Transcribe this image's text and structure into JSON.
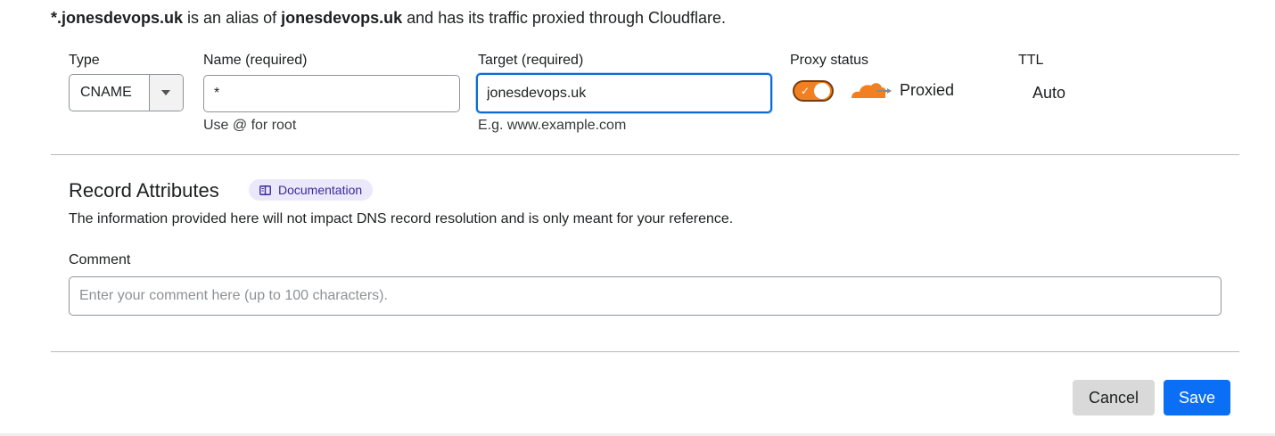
{
  "summary": {
    "alias_name": "*.jonesdevops.uk",
    "text1": " is an alias of ",
    "target_name": "jonesdevops.uk",
    "text2": " and has its traffic proxied through Cloudflare."
  },
  "record_form": {
    "type": {
      "label": "Type",
      "value": "CNAME"
    },
    "name": {
      "label": "Name (required)",
      "value": "*",
      "hint": "Use @ for root"
    },
    "target": {
      "label": "Target (required)",
      "value": "jonesdevops.uk",
      "hint": "E.g. www.example.com"
    },
    "proxy": {
      "label": "Proxy status",
      "status": "Proxied",
      "enabled": true
    },
    "ttl": {
      "label": "TTL",
      "value": "Auto"
    }
  },
  "attributes": {
    "title": "Record Attributes",
    "doc_label": "Documentation",
    "description": "The information provided here will not impact DNS record resolution and is only meant for your reference.",
    "comment_label": "Comment",
    "comment_value": "",
    "comment_placeholder": "Enter your comment here (up to 100 characters)."
  },
  "actions": {
    "cancel": "Cancel",
    "save": "Save"
  },
  "colors": {
    "accent": "#0b6ff5",
    "proxy_orange": "#f38020",
    "doc_badge_bg": "#ece8fb",
    "doc_badge_text": "#3a2a9a"
  },
  "icons": {
    "type_arrow": "triangle-down-icon",
    "proxy_cloud": "cloudflare-cloud-icon",
    "doc": "book-icon"
  }
}
